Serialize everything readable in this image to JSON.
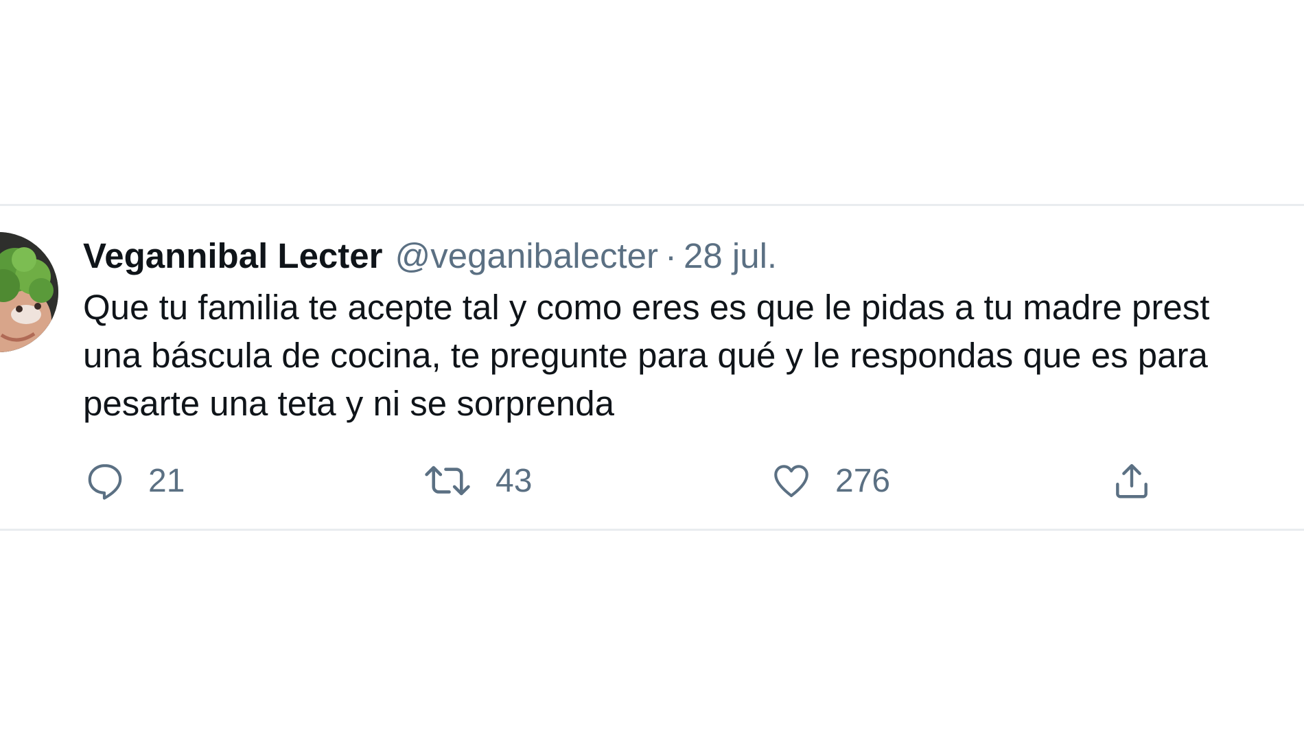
{
  "tweet": {
    "author_name": "Vegannibal Lecter",
    "handle": "@veganibalecter",
    "separator": "·",
    "date": "28 jul.",
    "lines": [
      "Que tu familia te acepte tal y como eres es que le pidas a tu madre prest",
      "una báscula de cocina, te pregunte para qué y le respondas que es para",
      "pesarte una teta y ni se sorprenda"
    ],
    "actions": {
      "reply": {
        "icon": "reply-icon",
        "count": "21"
      },
      "retweet": {
        "icon": "retweet-icon",
        "count": "43"
      },
      "like": {
        "icon": "heart-icon",
        "count": "276"
      },
      "share": {
        "icon": "share-icon"
      }
    }
  },
  "colors": {
    "text_primary": "#0f1419",
    "text_secondary": "#5b7083",
    "divider": "#e9ecef",
    "background": "#ffffff"
  }
}
